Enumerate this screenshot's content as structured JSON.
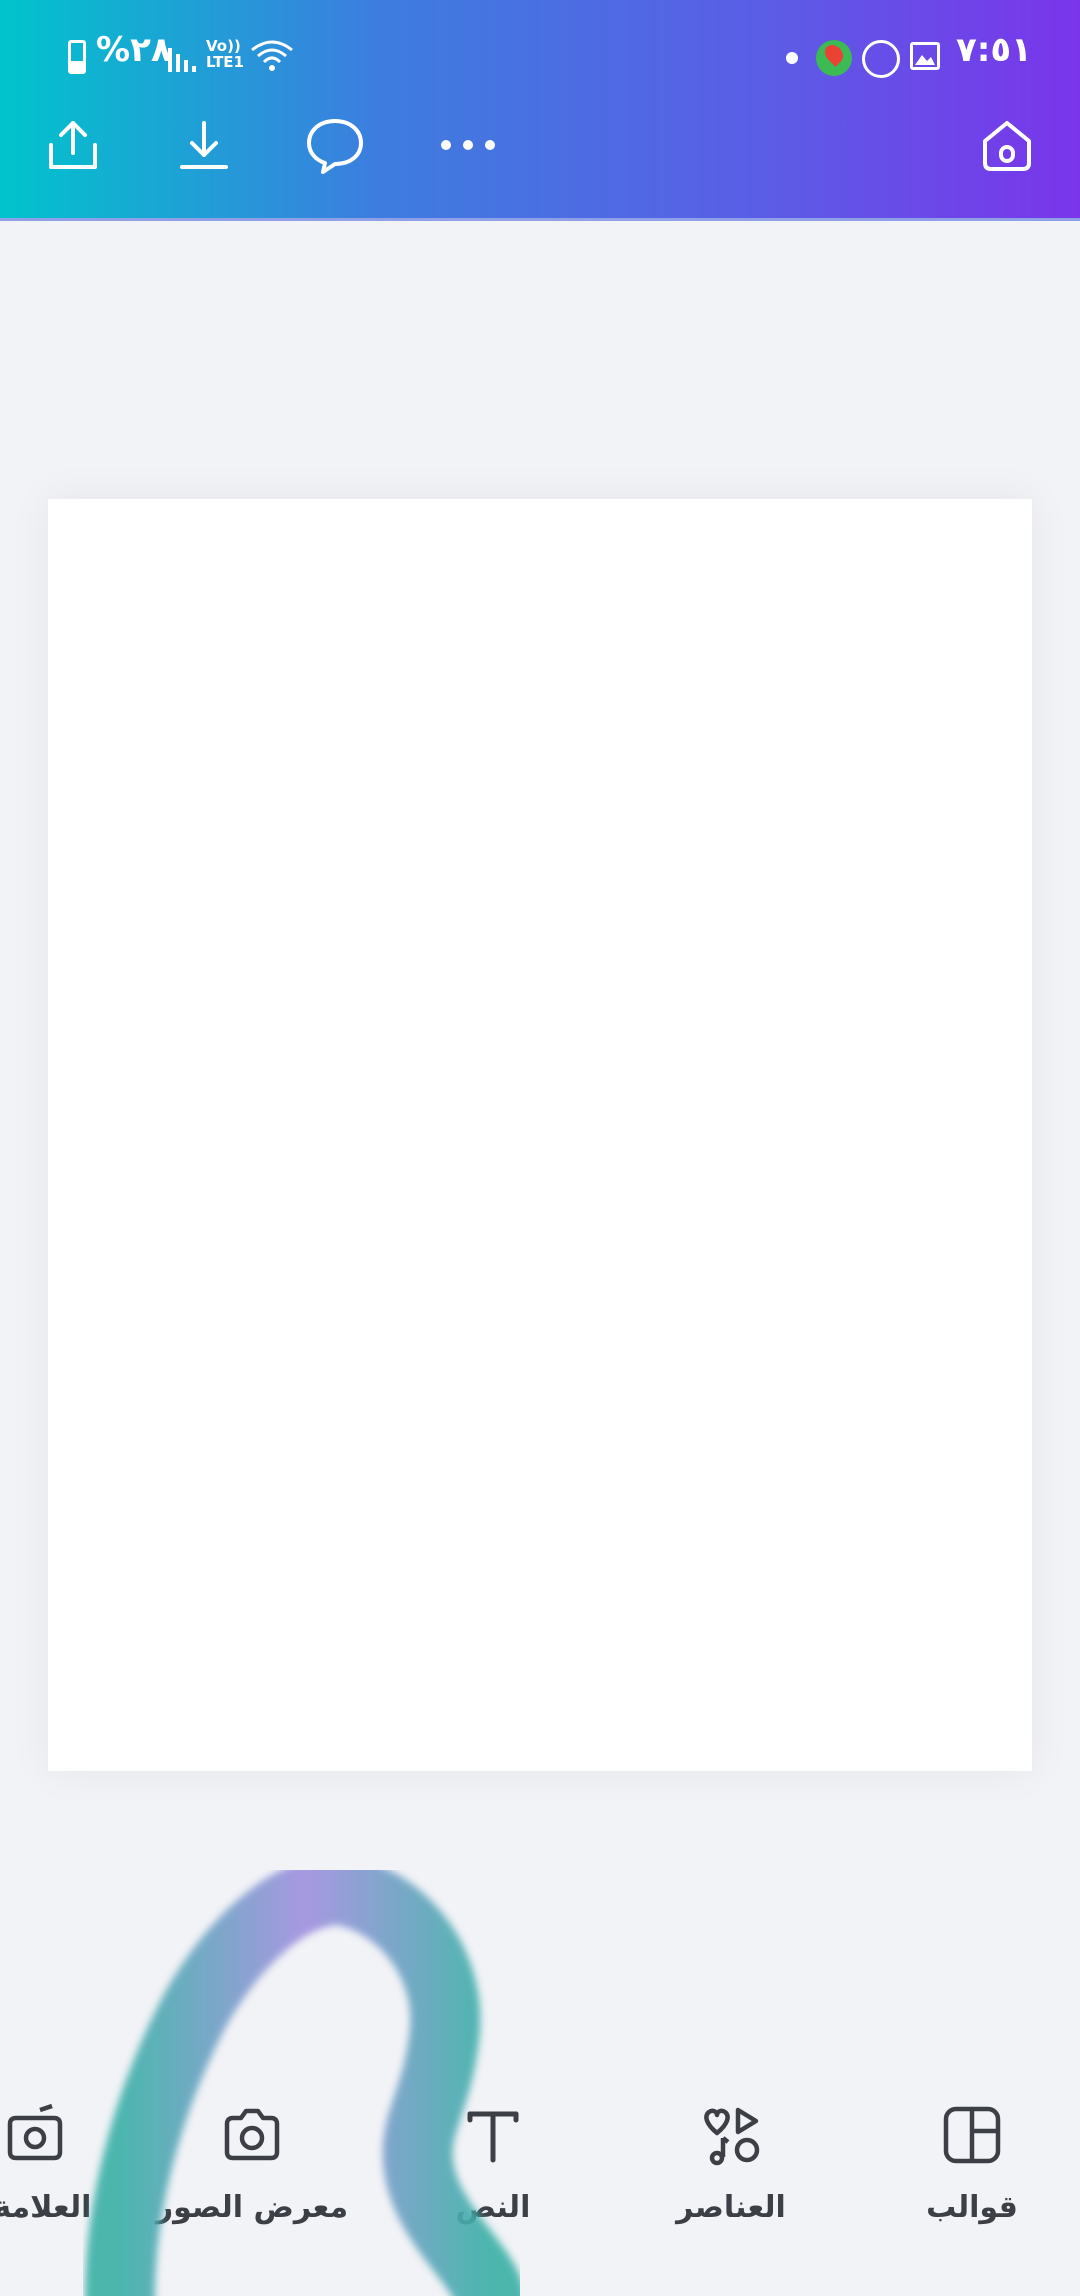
{
  "status_bar": {
    "time": "٧:٥١",
    "battery": "%٢٨",
    "network": "Vo)) LTE1"
  },
  "toolbar": {
    "icons": [
      "share-icon",
      "download-icon",
      "comment-icon",
      "more-icon",
      "home-icon"
    ]
  },
  "bottom_tools": [
    {
      "label": "قوالب",
      "icon": "templates-icon"
    },
    {
      "label": "العناصر",
      "icon": "elements-icon"
    },
    {
      "label": "النص",
      "icon": "text-icon"
    },
    {
      "label": "معرض الصور",
      "icon": "camera-icon"
    },
    {
      "label": "العلامة ا",
      "icon": "brand-icon"
    }
  ],
  "colors": {
    "gradient_start": "#00c4cc",
    "gradient_end": "#7a35ea",
    "canvas_bg": "#f2f3f7",
    "page_bg": "#ffffff",
    "tool_text": "#3c3f45"
  }
}
